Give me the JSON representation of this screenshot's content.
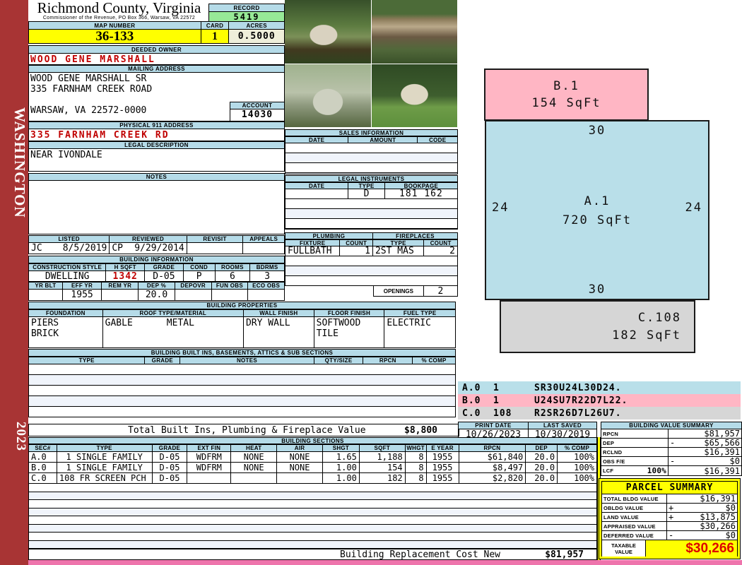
{
  "page": {
    "state_label": "WASHINGTON",
    "year": "2023"
  },
  "colors": {
    "header_blue": "#b5dbe8",
    "highlight_yellow": "#ffff00",
    "record_green": "#97e997",
    "sidebar_red": "#a83434",
    "alert_red": "#c00000",
    "sketch_blue": "#b9dfe9",
    "sketch_pink": "#ffb6c4",
    "sketch_gray": "#d6d6d6",
    "bottom_strip_pink": "#ee74ac"
  },
  "header": {
    "county": "Richmond County, Virginia",
    "office": "Commissioner of the Revenue, PO Box 366, Warsaw, VA 22572",
    "record_label": "RECORD",
    "record_value": "5419"
  },
  "parcel": {
    "map_number_label": "MAP NUMBER",
    "map_number": "36-133",
    "card_label": "CARD",
    "card": "1",
    "acres_label": "ACRES",
    "acres": "0.5000",
    "deeded_owner_label": "DEEDED OWNER",
    "deeded_owner": "WOOD GENE MARSHALL",
    "mailing_address_label": "MAILING ADDRESS",
    "mailing_line1": "WOOD GENE MARSHALL SR",
    "mailing_line2": "335 FARNHAM CREEK ROAD",
    "mailing_line3": "WARSAW, VA 22572-0000",
    "account_label": "ACCOUNT",
    "account": "14030",
    "physical_address_label": "PHYSICAL 911 ADDRESS",
    "physical_address": "335 FARNHAM CREEK RD",
    "legal_description_label": "LEGAL DESCRIPTION",
    "legal_description": "NEAR IVONDALE",
    "notes_label": "NOTES",
    "notes": ""
  },
  "review": {
    "headers": [
      "LISTED",
      "REVIEWED",
      "REVISIT",
      "APPEALS"
    ],
    "listed_by": "JC",
    "listed_date": "8/5/2019",
    "reviewed_by": "CP",
    "reviewed_date": "9/29/2014",
    "revisit": "",
    "appeals": ""
  },
  "building_information": {
    "label": "BUILDING INFORMATION",
    "row1_headers": [
      "CONSTRUCTION STYLE",
      "H SQFT",
      "GRADE",
      "COND",
      "ROOMS",
      "BDRMS"
    ],
    "row1_values": [
      "DWELLING",
      "1342",
      "D-05",
      "P",
      "6",
      "3"
    ],
    "row2_headers": [
      "YR BLT",
      "EFF YR",
      "REM YR",
      "DEP %",
      "DEPOVR",
      "FUN OBS",
      "ECO OBS"
    ],
    "row2_values": [
      "",
      "1955",
      "",
      "20.0",
      "",
      "",
      ""
    ]
  },
  "building_properties": {
    "label": "BUILDING PROPERTIES",
    "headers": [
      "FOUNDATION",
      "ROOF TYPE/MATERIAL",
      "WALL FINISH",
      "FLOOR FINISH",
      "FUEL TYPE"
    ],
    "foundation_line1": "PIERS",
    "foundation_line2": "BRICK",
    "roof_type": "GABLE",
    "roof_material": "METAL",
    "wall_finish": "DRY WALL",
    "floor_finish_line1": "SOFTWOOD",
    "floor_finish_line2": "TILE",
    "fuel_type": "ELECTRIC"
  },
  "built_ins": {
    "label": "BUILDING BUILT INS, BASEMENTS, ATTICS & SUB SECTIONS",
    "headers": [
      "TYPE",
      "GRADE",
      "NOTES",
      "QTY/SIZE",
      "RPCN",
      "% COMP"
    ],
    "total_label": "Total Built Ins, Plumbing & Fireplace Value",
    "total_value": "$8,800"
  },
  "sales": {
    "label": "SALES INFORMATION",
    "headers": [
      "DATE",
      "AMOUNT",
      "CODE"
    ]
  },
  "legal_instruments": {
    "label": "LEGAL INSTRUMENTS",
    "headers": [
      "DATE",
      "TYPE",
      "BOOKPAGE"
    ],
    "rows": [
      {
        "date": "",
        "type": "D",
        "bookpage": "181 162"
      }
    ]
  },
  "plumbing": {
    "label": "PLUMBING",
    "headers": [
      "FIXTURE",
      "COUNT"
    ],
    "rows": [
      {
        "fixture": "FULLBATH",
        "count": "1"
      }
    ]
  },
  "fireplaces": {
    "label": "FIREPLACES",
    "headers": [
      "TYPE",
      "COUNT"
    ],
    "rows": [
      {
        "type": "2ST MAS",
        "count": "2"
      }
    ],
    "openings_label": "OPENINGS",
    "openings_value": "2"
  },
  "sketch": {
    "sections": [
      {
        "id": "B.1",
        "sqft": "154 SqFt"
      },
      {
        "id": "A.1",
        "sqft": "720 SqFt",
        "dim_top": "30",
        "dim_left": "24",
        "dim_right": "24",
        "dim_bottom": "30"
      },
      {
        "id": "C.108",
        "sqft": "182 SqFt"
      }
    ],
    "legend": [
      {
        "sec": "A.0",
        "qty": "1",
        "trace": "SR30U24L30D24."
      },
      {
        "sec": "B.0",
        "qty": "1",
        "trace": "U24SU7R22D7L22."
      },
      {
        "sec": "C.0",
        "qty": "108",
        "trace": "R2SR26D7L26U7."
      }
    ]
  },
  "print_info": {
    "print_date_label": "PRINT DATE",
    "print_date": "10/26/2023",
    "last_saved_label": "LAST SAVED",
    "last_saved": "10/30/2019"
  },
  "building_value_summary": {
    "label": "BUILDING VALUE SUMMARY",
    "rows": [
      {
        "label": "RPCN",
        "sub": "",
        "op": "",
        "value": "$81,957"
      },
      {
        "label": "DEP",
        "sub": "",
        "op": "-",
        "value": "$65,566"
      },
      {
        "label": "RCLND",
        "sub": "",
        "op": "",
        "value": "$16,391"
      },
      {
        "label": "OBS F/E",
        "sub": "",
        "op": "-",
        "value": "$0"
      },
      {
        "label": "LCF",
        "sub": "100%",
        "op": "",
        "value": "$16,391"
      }
    ]
  },
  "building_sections": {
    "label": "BUILDING SECTIONS",
    "headers": [
      "SEC#",
      "TYPE",
      "GRADE",
      "EXT FIN",
      "HEAT",
      "AIR",
      "SHGT",
      "SQFT",
      "WHGT",
      "E YEAR",
      "RPCN",
      "DEP",
      "% COMP"
    ],
    "rows": [
      [
        "A.0",
        "1 SINGLE FAMILY",
        "D-05",
        "WDFRM",
        "NONE",
        "NONE",
        "1.65",
        "1,188",
        "8",
        "1955",
        "$61,840",
        "20.0",
        "100%"
      ],
      [
        "B.0",
        "1 SINGLE FAMILY",
        "D-05",
        "WDFRM",
        "NONE",
        "NONE",
        "1.00",
        "154",
        "8",
        "1955",
        "$8,497",
        "20.0",
        "100%"
      ],
      [
        "C.0",
        "108 FR SCREEN PCH",
        "D-05",
        "",
        "",
        "",
        "1.00",
        "182",
        "8",
        "1955",
        "$2,820",
        "20.0",
        "100%"
      ]
    ],
    "footer_label": "Building Replacement Cost New",
    "footer_value": "$81,957"
  },
  "parcel_summary": {
    "label": "PARCEL SUMMARY",
    "rows": [
      {
        "label": "TOTAL BLDG VALUE",
        "op": "",
        "value": "$16,391"
      },
      {
        "label": "OBLDG VALUE",
        "op": "+",
        "value": "$0"
      },
      {
        "label": "LAND VALUE",
        "op": "+",
        "value": "$13,875"
      },
      {
        "label": "APPRAISED VALUE",
        "op": "",
        "value": "$30,266"
      },
      {
        "label": "DEFERRED VALUE",
        "op": "-",
        "value": "$0"
      }
    ],
    "taxable_label": "TAXABLE VALUE",
    "taxable_value": "$30,266"
  }
}
